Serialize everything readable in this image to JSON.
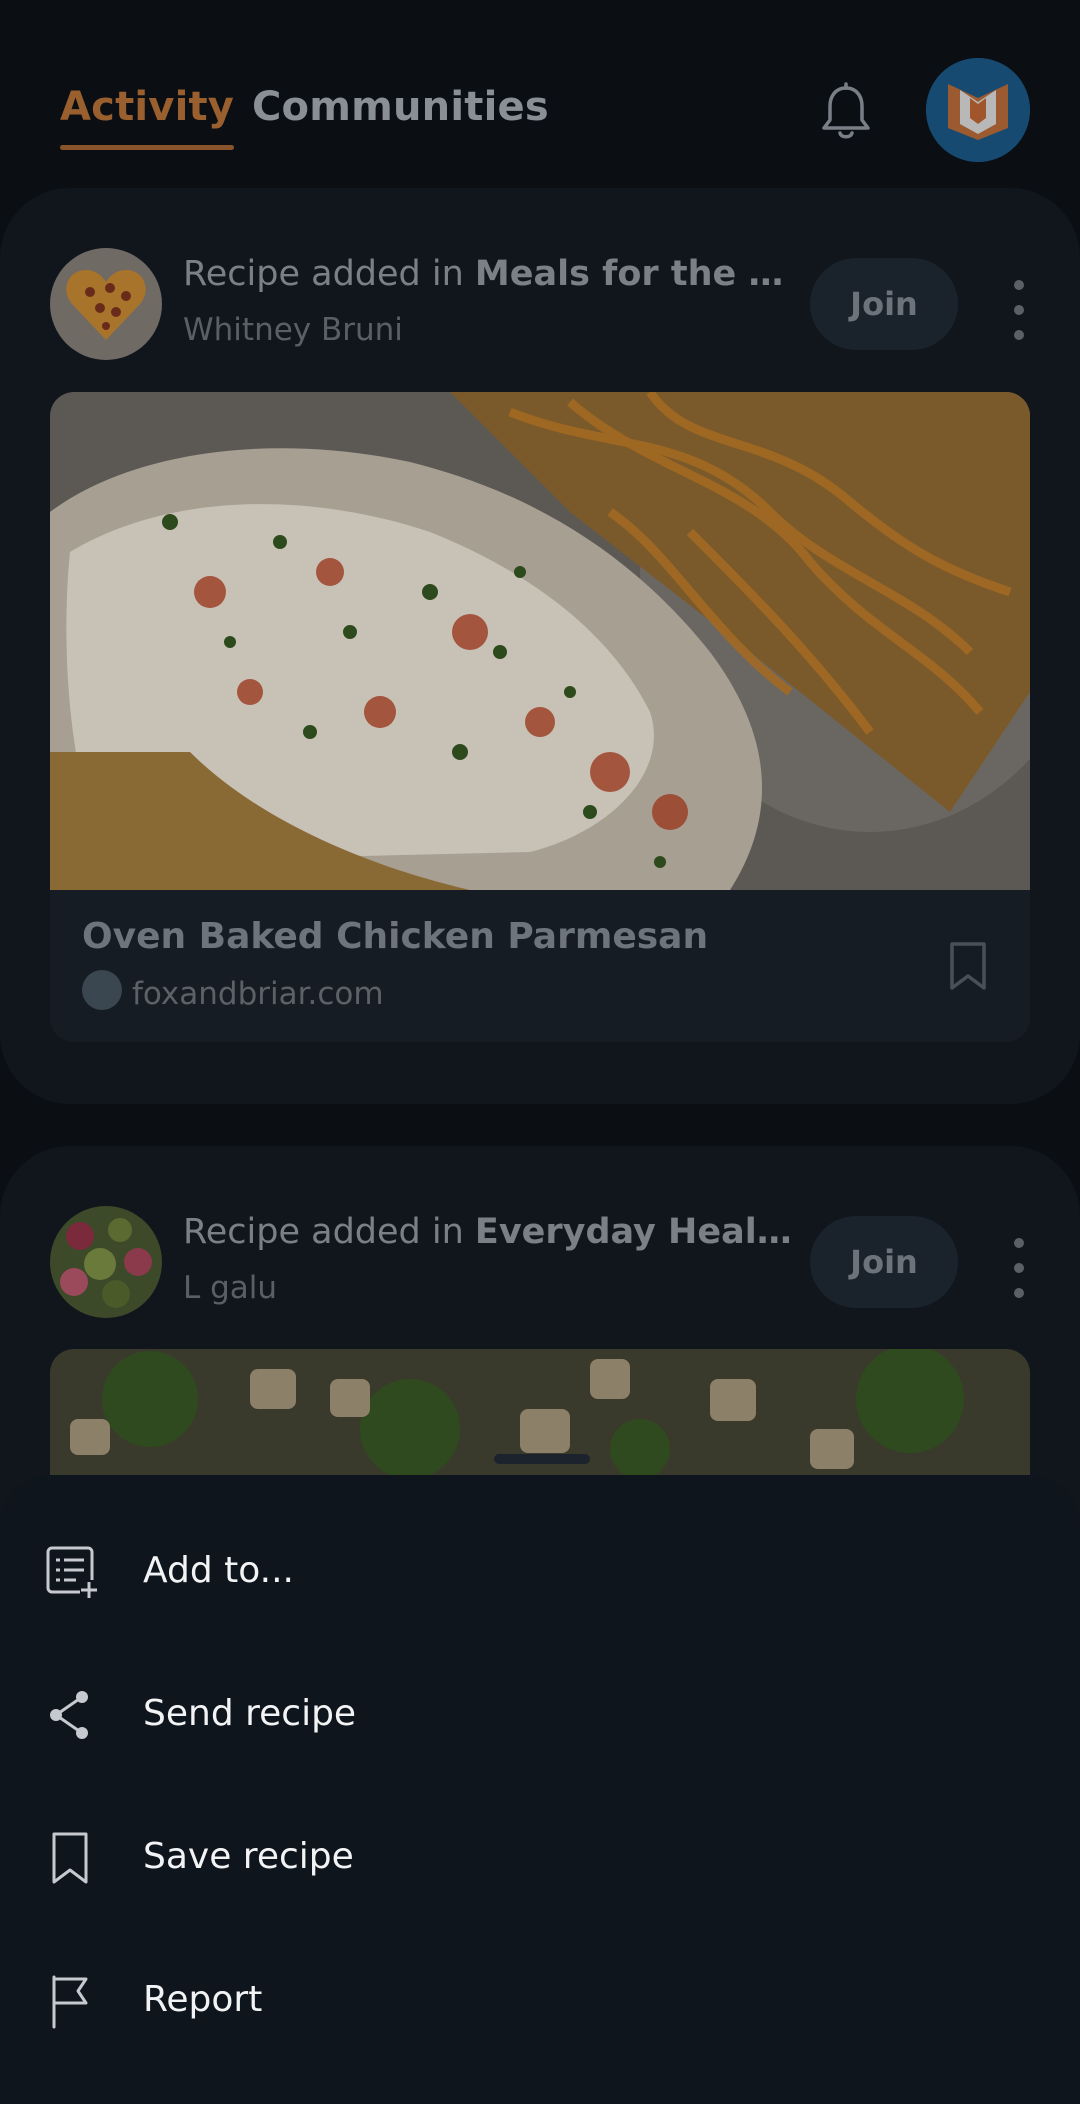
{
  "header": {
    "tabs": [
      {
        "label": "Activity",
        "active": true
      },
      {
        "label": "Communities",
        "active": false
      }
    ],
    "accent_color": "#9a5f2e"
  },
  "feed": [
    {
      "title_prefix": "Recipe added in ",
      "community": " Meals for the F...",
      "author": "Whitney Bruni",
      "join_label": "Join",
      "recipe_name": "Oven Baked Chicken Parmesan",
      "recipe_source": "foxandbriar.com"
    },
    {
      "title_prefix": "Recipe added in ",
      "community": "Everyday Healt...",
      "author": "L galu",
      "join_label": "Join"
    }
  ],
  "sheet": {
    "items": [
      {
        "label": "Add to...",
        "icon": "add-to-list-icon"
      },
      {
        "label": "Send recipe",
        "icon": "share-icon"
      },
      {
        "label": "Save recipe",
        "icon": "bookmark-icon"
      },
      {
        "label": "Report",
        "icon": "flag-icon"
      }
    ]
  }
}
